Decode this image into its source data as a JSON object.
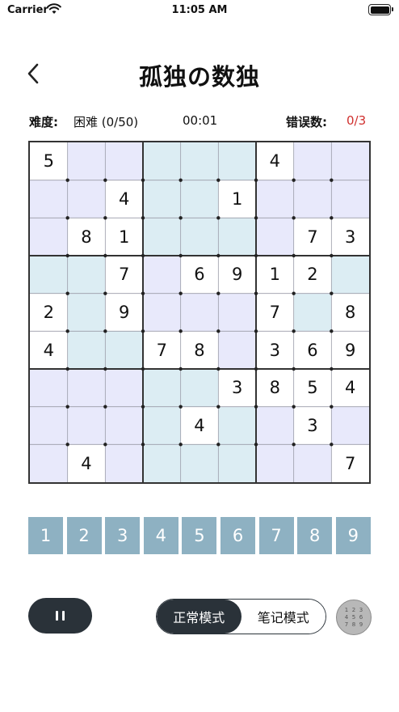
{
  "status": {
    "carrier": "Carrier",
    "time": "11:05 AM"
  },
  "header": {
    "title": "孤独の数独",
    "back_icon": "chevron-left-icon"
  },
  "info": {
    "difficulty_label": "难度:",
    "difficulty_value": "困难 (0/50)",
    "timer": "00:01",
    "errors_label": "错误数:",
    "errors_value": "0/3"
  },
  "board": {
    "values": [
      "5",
      "",
      "",
      "",
      "",
      "",
      "4",
      "",
      "",
      "",
      "",
      "4",
      "",
      "",
      "1",
      "",
      "",
      "",
      "",
      "8",
      "1",
      "",
      "",
      "",
      "",
      "7",
      "3",
      "",
      "",
      "7",
      "",
      "6",
      "9",
      "1",
      "2",
      "",
      "2",
      "",
      "9",
      "",
      "",
      "",
      "7",
      "",
      "8",
      "4",
      "",
      "",
      "7",
      "8",
      "",
      "3",
      "6",
      "9",
      "",
      "",
      "",
      "",
      "",
      "3",
      "8",
      "5",
      "4",
      "",
      "",
      "",
      "",
      "4",
      "",
      "",
      "3",
      "",
      "",
      "4",
      "",
      "",
      "",
      "",
      "",
      "",
      "7"
    ],
    "shading": [
      "W",
      "L",
      "L",
      "C",
      "C",
      "C",
      "W",
      "L",
      "L",
      "L",
      "L",
      "W",
      "C",
      "C",
      "W",
      "L",
      "L",
      "L",
      "L",
      "W",
      "W",
      "C",
      "C",
      "C",
      "L",
      "W",
      "W",
      "C",
      "C",
      "W",
      "L",
      "W",
      "W",
      "W",
      "W",
      "C",
      "W",
      "C",
      "W",
      "L",
      "L",
      "L",
      "W",
      "C",
      "W",
      "W",
      "C",
      "C",
      "W",
      "W",
      "L",
      "W",
      "W",
      "W",
      "L",
      "L",
      "L",
      "C",
      "C",
      "W",
      "W",
      "W",
      "W",
      "L",
      "L",
      "L",
      "C",
      "W",
      "C",
      "L",
      "W",
      "L",
      "L",
      "W",
      "L",
      "C",
      "C",
      "C",
      "L",
      "L",
      "W"
    ],
    "colors": {
      "lavender": "#e8e9fb",
      "cyan": "#dcedf3",
      "white": "#ffffff",
      "grid": "#333333"
    }
  },
  "numpad": {
    "keys": [
      "1",
      "2",
      "3",
      "4",
      "5",
      "6",
      "7",
      "8",
      "9"
    ],
    "color": "#8eb1c2"
  },
  "controls": {
    "pause_icon": "pause-icon",
    "normal_mode": "正常模式",
    "notes_mode": "笔记模式",
    "notes_digits": [
      "1",
      "2",
      "3",
      "4",
      "5",
      "6",
      "7",
      "8",
      "9"
    ],
    "accent": "#2a3239"
  }
}
